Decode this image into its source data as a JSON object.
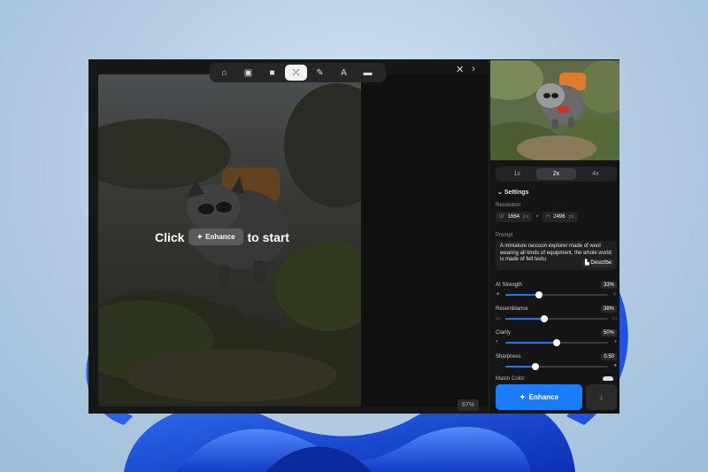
{
  "toolbar": {
    "tools": [
      {
        "icon": "home-icon",
        "glyph": "⌂",
        "active": false
      },
      {
        "icon": "image-icon",
        "glyph": "▣",
        "active": false
      },
      {
        "icon": "video-icon",
        "glyph": "■",
        "active": false
      },
      {
        "icon": "enhance-wand-icon",
        "glyph": "⤫",
        "active": true
      },
      {
        "icon": "brush-icon",
        "glyph": "✎",
        "active": false
      },
      {
        "icon": "text-icon",
        "glyph": "A",
        "active": false
      },
      {
        "icon": "folder-icon",
        "glyph": "▬",
        "active": false
      }
    ],
    "close_glyph": "✕",
    "next_glyph": "›"
  },
  "canvas": {
    "cta_click": "Click",
    "cta_button": "Enhance",
    "cta_suffix": "to start",
    "zoom": "67%"
  },
  "panel": {
    "scales": [
      "1x",
      "2x",
      "4x"
    ],
    "active_scale": "2x",
    "settings_title": "Settings",
    "resolution_label": "Resolution",
    "width_key": "W",
    "width_value": "1664",
    "height_key": "H",
    "height_value": "2496",
    "unit": "px",
    "times": "×",
    "prompt_label": "Prompt",
    "prompt_text": "A miniature raccoon explorer made of wool wearing all kinds of equipment, the whole world is made of felt textu",
    "describe_label": "Describe",
    "sliders": [
      {
        "name": "AI Strength",
        "value": "33%",
        "fraction": 0.33
      },
      {
        "name": "Resemblance",
        "value": "38%",
        "fraction": 0.38
      },
      {
        "name": "Clarity",
        "value": "50%",
        "fraction": 0.5
      },
      {
        "name": "Sharpness",
        "value": "0.50",
        "fraction": 0.29
      }
    ],
    "partial_label": "Match Color",
    "enhance_label": "Enhance"
  },
  "colors": {
    "accent": "#1b7cff"
  }
}
